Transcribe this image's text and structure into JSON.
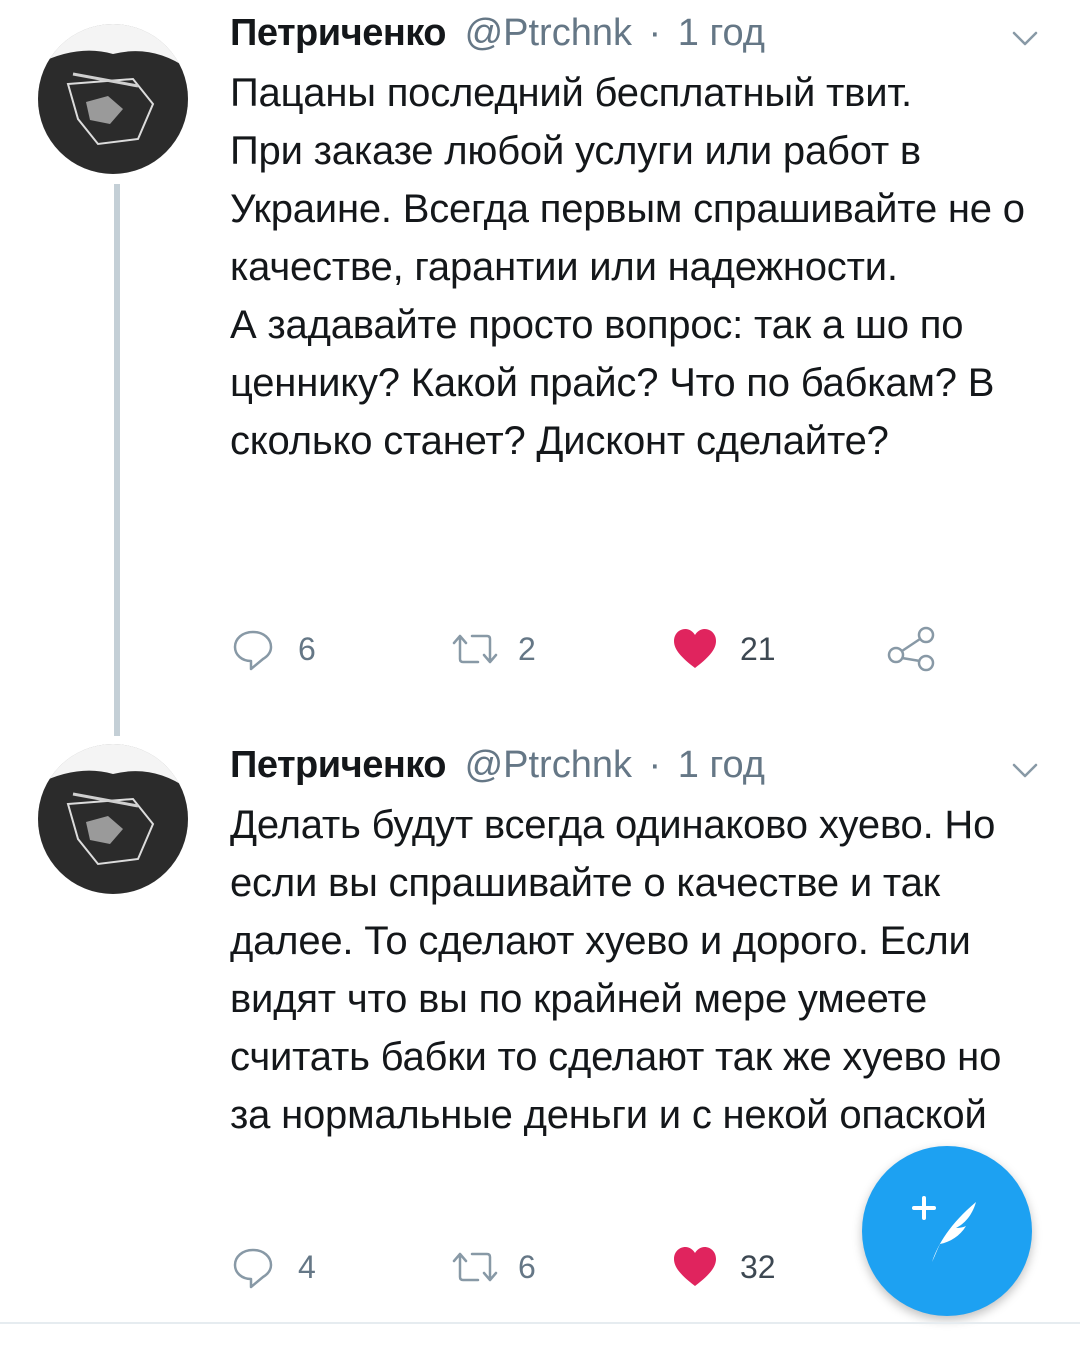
{
  "colors": {
    "accent": "#1da1f2",
    "like": "#e0245e",
    "muted": "#657786",
    "thread_line": "#c4cfd6"
  },
  "tweets": [
    {
      "display_name": "Петриченко",
      "handle": "@Ptrchnk",
      "separator": "·",
      "time": "1 год",
      "text": "Пацаны последний бесплатный твит.\nПри заказе любой услуги или работ в Украине. Всегда первым спрашивайте не о качестве, гарантии или надежности.\nА задавайте просто вопрос: так а шо по ценнику? Какой прайс? Что по бабкам? В сколько станет? Дисконт сделайте?",
      "replies": "6",
      "retweets": "2",
      "likes": "21",
      "liked": true,
      "icons": {
        "reply": "reply-icon",
        "retweet": "retweet-icon",
        "like": "heart-icon",
        "share": "share-icon",
        "menu": "chevron-down-icon"
      }
    },
    {
      "display_name": "Петриченко",
      "handle": "@Ptrchnk",
      "separator": "·",
      "time": "1 год",
      "text": "Делать будут всегда одинаково хуево. Но если вы спрашивайте о качестве и так далее. То сделают хуево и дорого. Если видят что вы по крайней мере умеете считать бабки то сделают так же хуево но за нормальные деньги и с некой опаской",
      "replies": "4",
      "retweets": "6",
      "likes": "32",
      "liked": true,
      "icons": {
        "reply": "reply-icon",
        "retweet": "retweet-icon",
        "like": "heart-icon",
        "menu": "chevron-down-icon"
      }
    }
  ],
  "fab": {
    "icon": "compose-tweet-icon",
    "symbol": "+"
  }
}
